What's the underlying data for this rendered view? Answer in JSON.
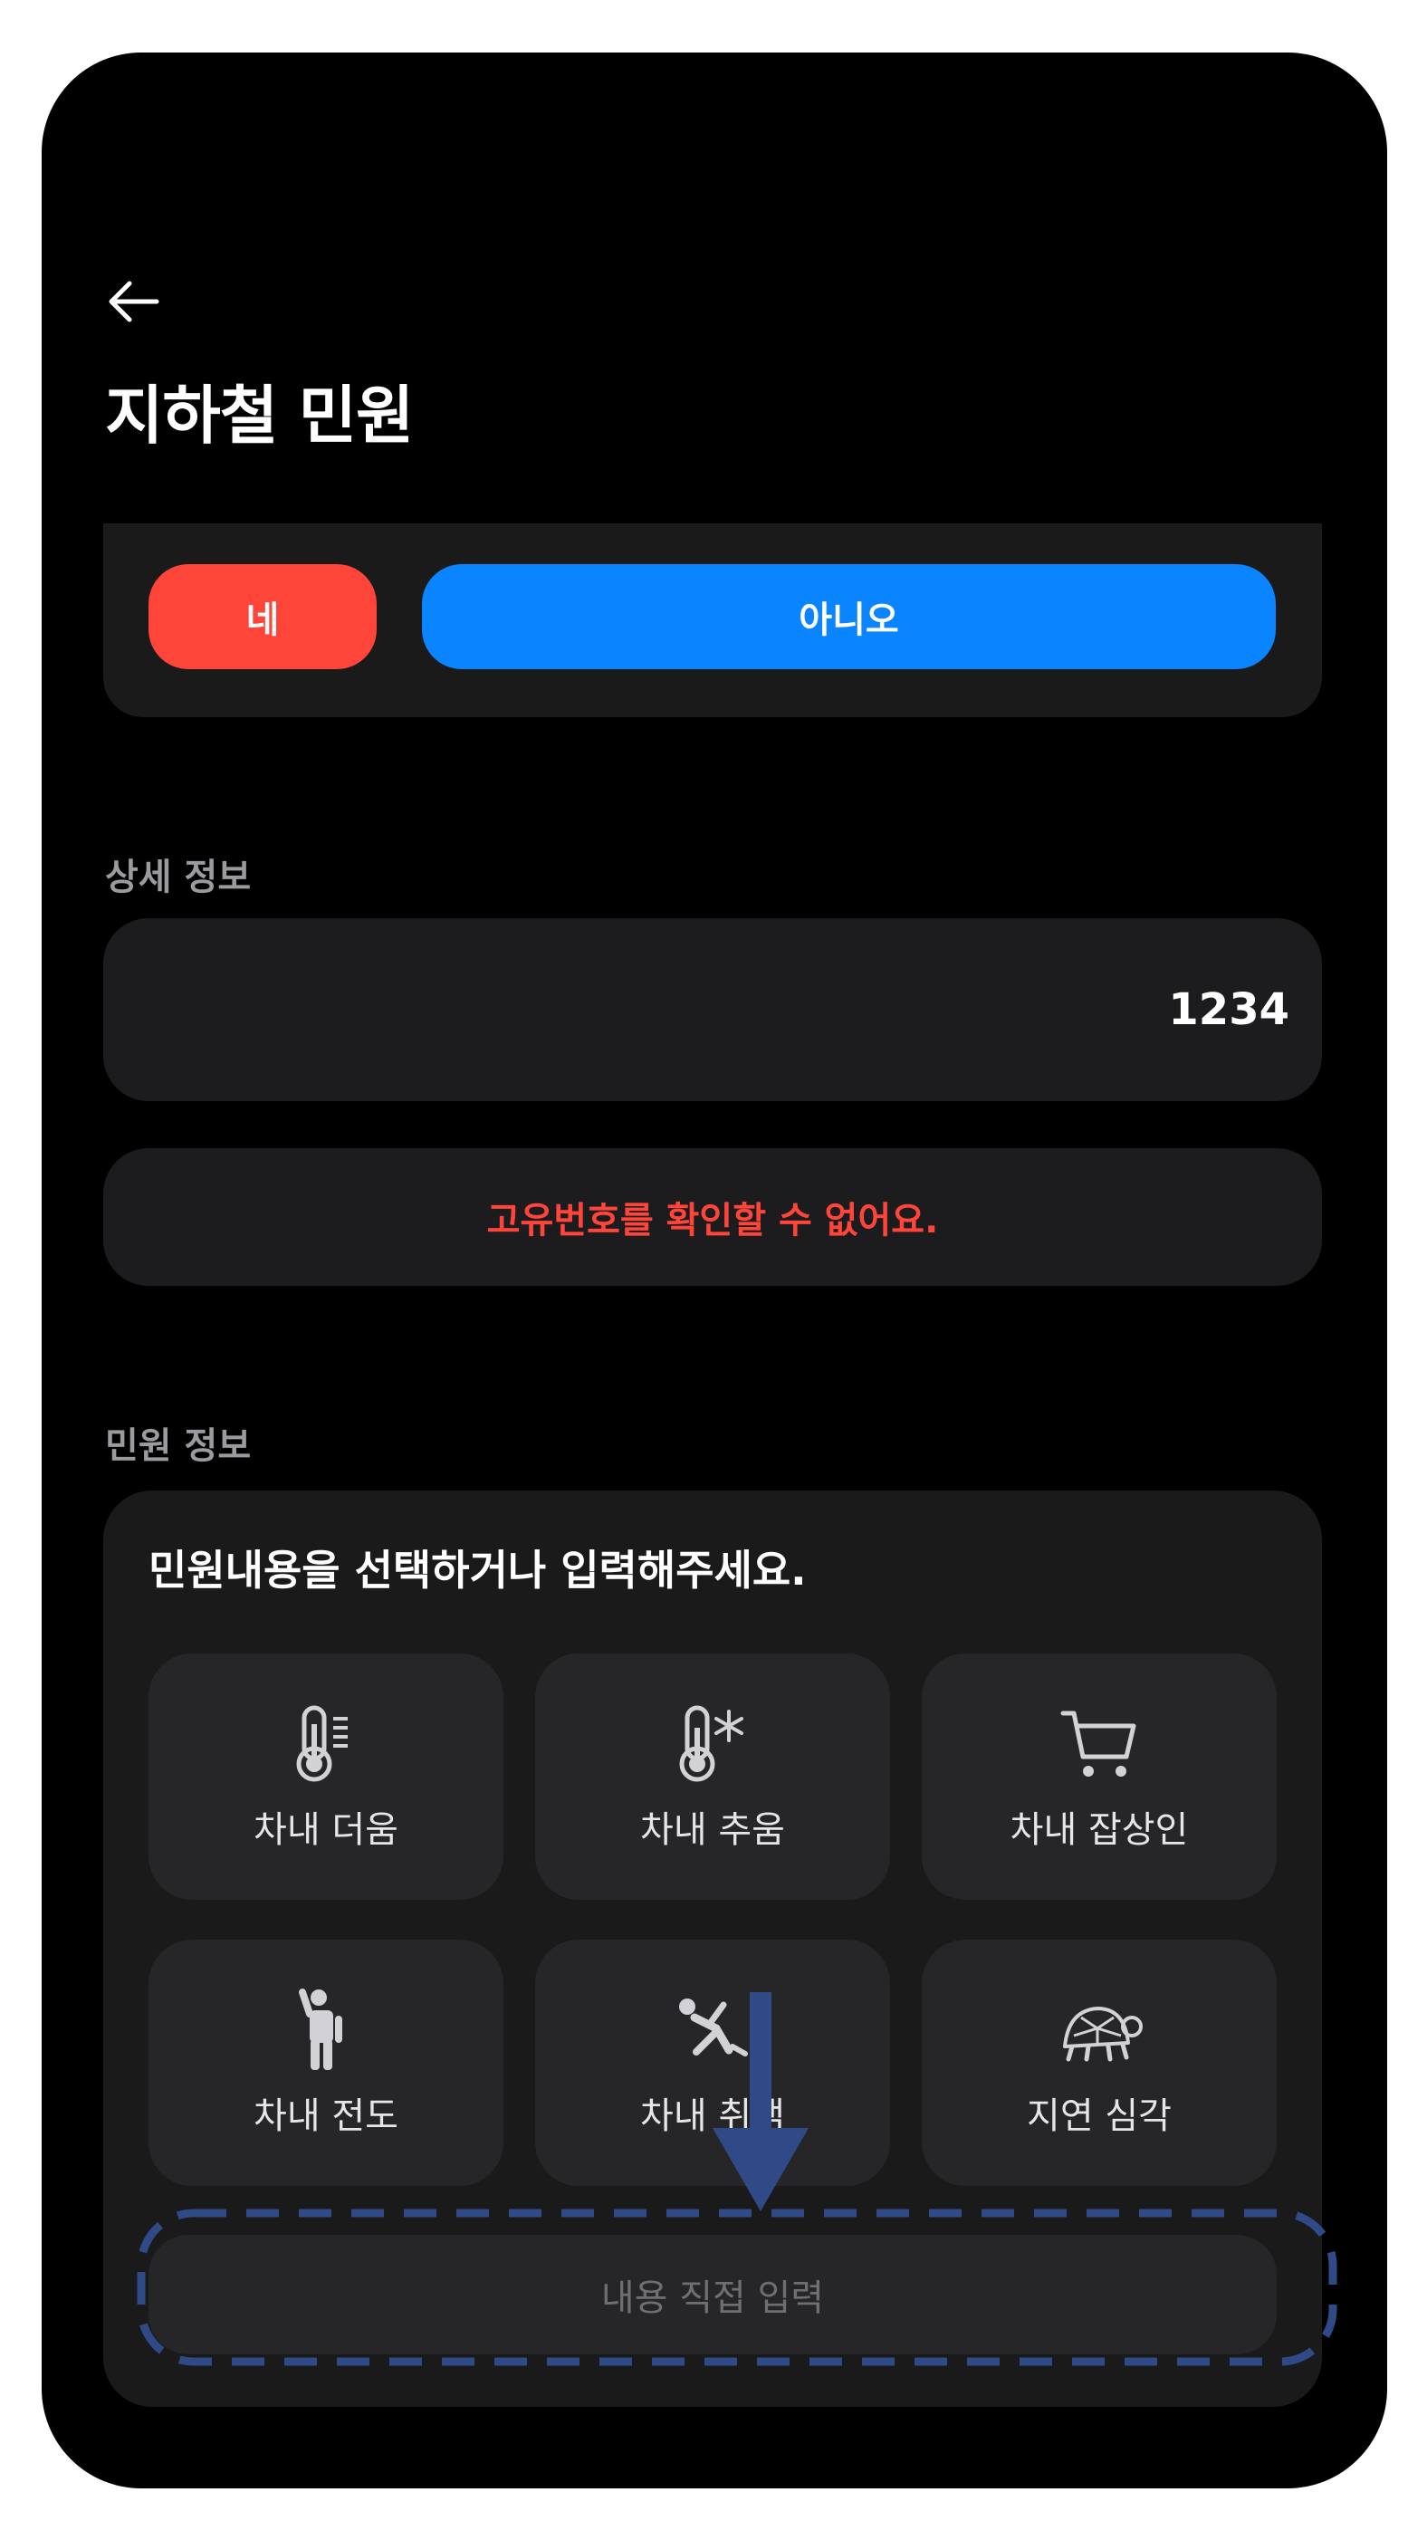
{
  "header": {
    "back_icon": "arrow-left-icon",
    "title": "지하철 민원"
  },
  "confirm": {
    "yes_label": "네",
    "no_label": "아니오",
    "yes_color": "#ff443a",
    "no_color": "#0a84ff"
  },
  "detail": {
    "section_label": "상세 정보",
    "value": "1234",
    "error_message": "고유번호를 확인할 수 없어요.",
    "error_color": "#ff453a"
  },
  "complaint": {
    "section_label": "민원 정보",
    "prompt": "민원내용을 선택하거나 입력해주세요.",
    "options": [
      {
        "label": "차내 더움",
        "icon": "thermometer-hot-icon"
      },
      {
        "label": "차내 추움",
        "icon": "thermometer-cold-icon"
      },
      {
        "label": "차내 잡상인",
        "icon": "shopping-cart-icon"
      },
      {
        "label": "차내 전도",
        "icon": "person-standing-icon"
      },
      {
        "label": "차내 취객",
        "icon": "person-falling-icon"
      },
      {
        "label": "지연 심각",
        "icon": "turtle-icon"
      }
    ],
    "direct_input_placeholder": "내용 직접 입력"
  },
  "overlay": {
    "arrow_icon": "arrow-down-icon",
    "highlight_color": "#2f4a86"
  }
}
